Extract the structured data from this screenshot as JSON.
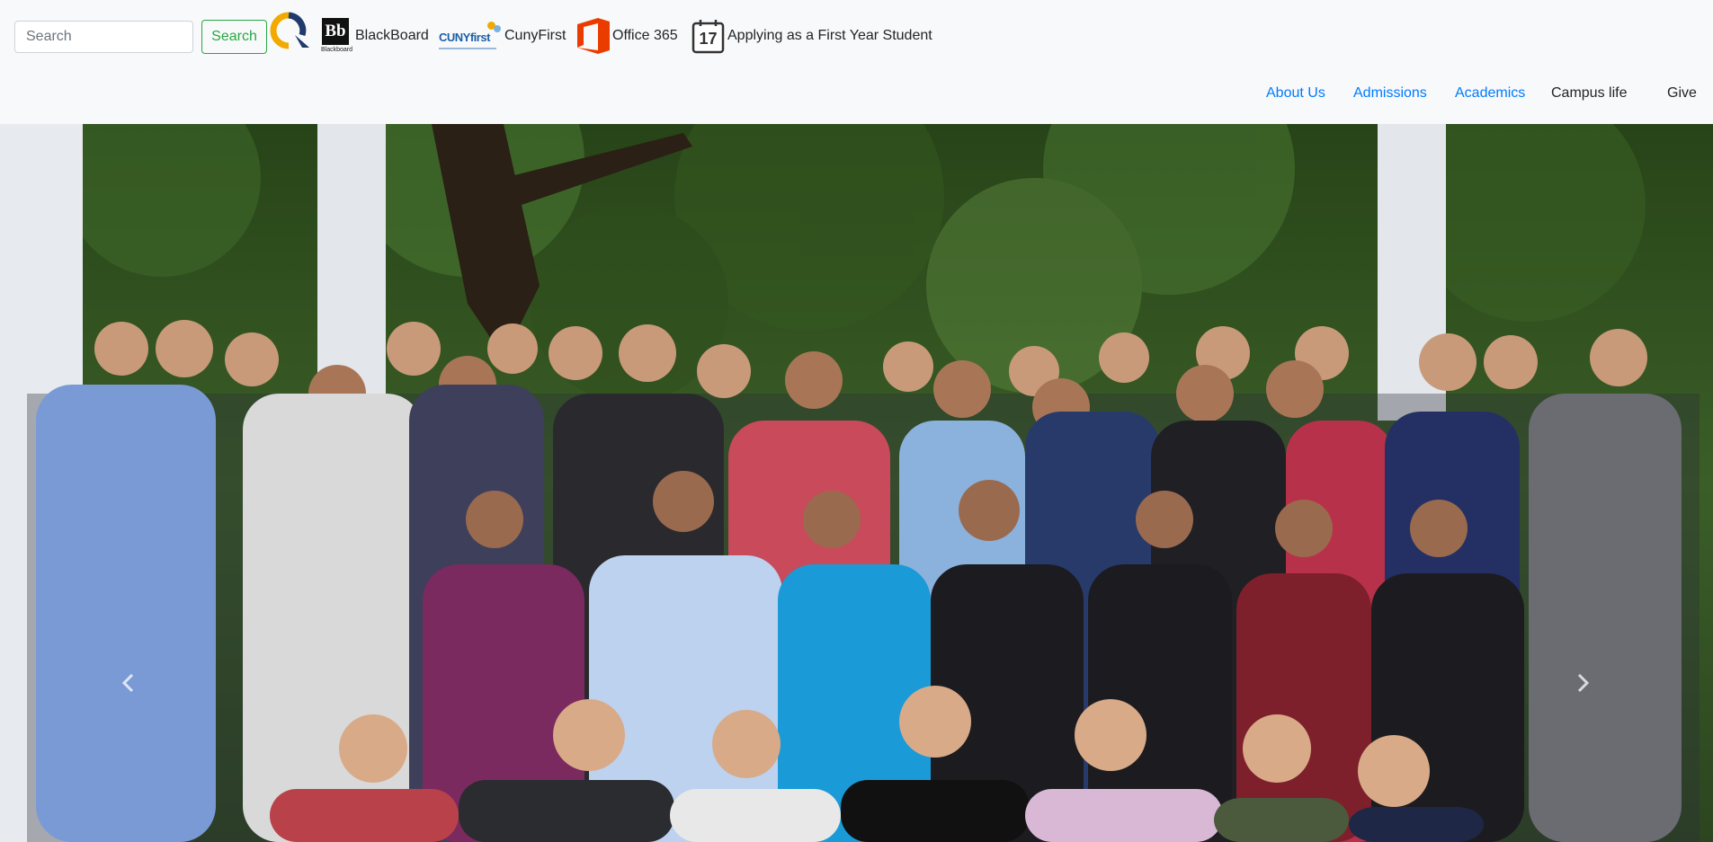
{
  "search": {
    "placeholder": "Search",
    "button_label": "Search"
  },
  "quicklinks": [
    {
      "label": "",
      "icon": "q-logo-icon"
    },
    {
      "label": "BlackBoard",
      "icon": "blackboard-logo-icon",
      "logo_text": "Bb",
      "logo_caption": "Blackboard"
    },
    {
      "label": "CunyFirst",
      "icon": "cunyfirst-logo-icon",
      "logo_text": "CUNYfirst"
    },
    {
      "label": "Office 365",
      "icon": "office-logo-icon"
    },
    {
      "label": "Applying as a First Year Student",
      "icon": "calendar-icon",
      "calendar_day": "17"
    }
  ],
  "nav": [
    {
      "label": "About Us",
      "color": "#007bff"
    },
    {
      "label": "Admissions",
      "color": "#007bff"
    },
    {
      "label": "Academics",
      "color": "#007bff"
    },
    {
      "label": "Campus life",
      "color": "#212529"
    },
    {
      "label": "Give",
      "color": "#212529"
    }
  ],
  "hero": {
    "controls": {
      "prev_icon": "chevron-left-icon",
      "next_icon": "chevron-right-icon"
    }
  },
  "colors": {
    "navbar_bg": "#f8f9fa",
    "link": "#007bff",
    "search_green": "#28a745"
  }
}
